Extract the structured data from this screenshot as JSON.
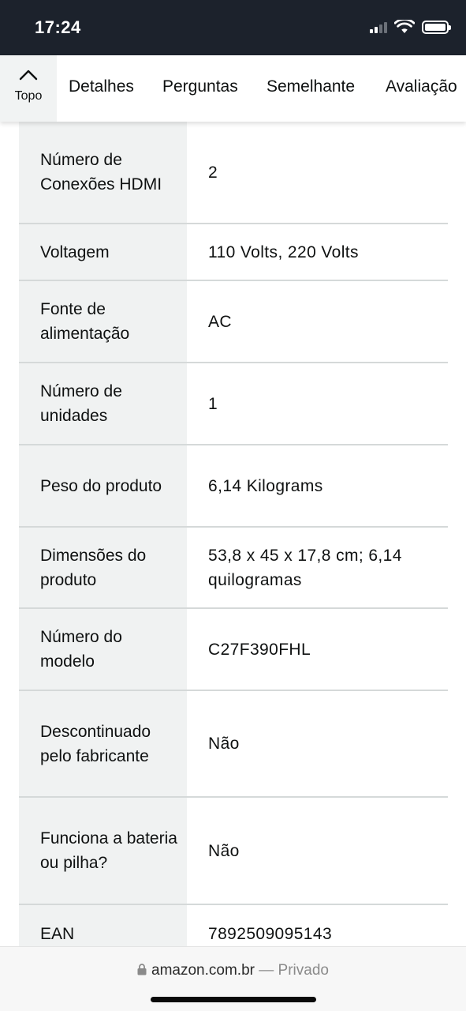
{
  "status_bar": {
    "time": "17:24"
  },
  "nav": {
    "top_label": "Topo",
    "tabs": [
      "Detalhes",
      "Perguntas",
      "Semelhante",
      "Avaliação"
    ]
  },
  "specs": [
    {
      "label": "Número de Conexões HDMI",
      "value": "2"
    },
    {
      "label": "Voltagem",
      "value": "110 Volts, 220 Volts"
    },
    {
      "label": "Fonte de alimentação",
      "value": "AC"
    },
    {
      "label": "Número de unidades",
      "value": "1"
    },
    {
      "label": "Peso do produto",
      "value": "6,14 Kilograms"
    },
    {
      "label": "Dimensões do produto",
      "value": "53,8 x 45 x 17,8 cm; 6,14 quilogramas"
    },
    {
      "label": "Número do modelo",
      "value": "C27F390FHL"
    },
    {
      "label": "Descontinuado pelo fabricante",
      "value": "Não"
    },
    {
      "label": "Funciona a bateria ou pilha?",
      "value": "Não"
    },
    {
      "label": "EAN",
      "value": "7892509095143"
    }
  ],
  "url_bar": {
    "domain": "amazon.com.br",
    "separator": " — ",
    "mode": "Privado"
  },
  "icons": {
    "top": "chevron-up-icon",
    "lock": "lock-icon",
    "wifi": "wifi-icon",
    "signal": "cellular-signal-icon",
    "battery": "battery-icon"
  },
  "colors": {
    "status_bar_bg": "#1c222c",
    "label_cell_bg": "#f0f2f2",
    "row_divider": "#d5d9d9"
  }
}
